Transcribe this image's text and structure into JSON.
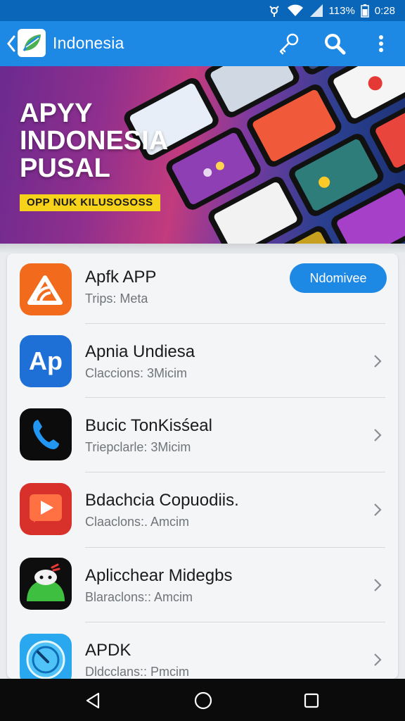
{
  "status_bar": {
    "battery_percent": "113%",
    "time": "0:28",
    "icons": [
      "usb-icon",
      "wifi-icon",
      "signal-icon",
      "battery-icon"
    ]
  },
  "app_bar": {
    "title": "Indonesia",
    "icons": [
      "back-icon",
      "app-logo-icon",
      "key-icon",
      "search-icon",
      "more-vert-icon"
    ],
    "color": "#1e88e5"
  },
  "banner": {
    "headline": [
      "APYY",
      "INDONESIA",
      "PUSAL"
    ],
    "tag": "OPP NUK KILUSOSOSS"
  },
  "apps": [
    {
      "name": "Apfk APP",
      "subtitle": "Trips: Meta",
      "action": "Ndomivee",
      "icon": "wifi-triangle-app-icon"
    },
    {
      "name": "Apnia Undiesa",
      "subtitle": "Claccions: 3Micim",
      "icon": "ap-letters-app-icon"
    },
    {
      "name": "Bucic TonKisśeal",
      "subtitle": "Triepclarle: 3Micim",
      "icon": "phone-app-icon"
    },
    {
      "name": "Bdachcia Copuodiis.",
      "subtitle": "Claaclons:. Amcim",
      "icon": "play-app-icon"
    },
    {
      "name": "Aplicchear Midegbs",
      "subtitle": "Blaraclons:: Amcim",
      "icon": "android-app-icon"
    },
    {
      "name": "APDK",
      "subtitle": "Dldcclans:: Pmcim",
      "icon": "compass-app-icon"
    }
  ],
  "nav_bar": {
    "icons": [
      "nav-back-icon",
      "nav-home-icon",
      "nav-recents-icon"
    ]
  },
  "colors": {
    "accent": "#1e88e5",
    "status_bar": "#0a66b8",
    "tag_yellow": "#f7d21b"
  }
}
